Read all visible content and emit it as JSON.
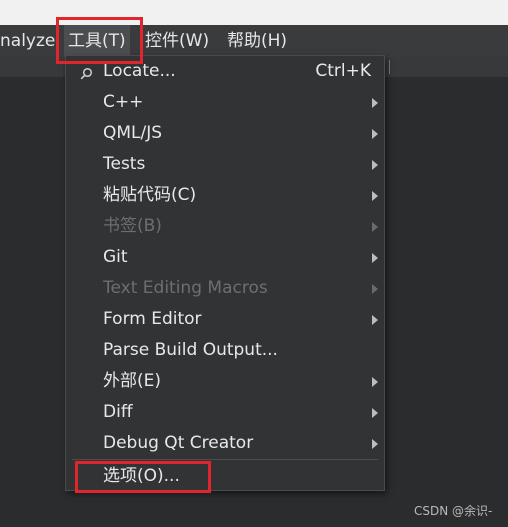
{
  "menubar": {
    "items": [
      {
        "label": "nalyze"
      },
      {
        "label": "工具(T)"
      },
      {
        "label": "控件(W)"
      },
      {
        "label": "帮助(H)"
      }
    ]
  },
  "tools_menu": {
    "items": [
      {
        "label": "Locate...",
        "shortcut": "Ctrl+K",
        "enabled": true,
        "submenu": false,
        "icon": "search-icon"
      },
      {
        "label": "C++",
        "enabled": true,
        "submenu": true
      },
      {
        "label": "QML/JS",
        "enabled": true,
        "submenu": true
      },
      {
        "label": "Tests",
        "enabled": true,
        "submenu": true
      },
      {
        "label": "粘贴代码(C)",
        "enabled": true,
        "submenu": true
      },
      {
        "label": "书签(B)",
        "enabled": false,
        "submenu": true
      },
      {
        "label": "Git",
        "enabled": true,
        "submenu": true
      },
      {
        "label": "Text Editing Macros",
        "enabled": false,
        "submenu": true
      },
      {
        "label": "Form Editor",
        "enabled": true,
        "submenu": true
      },
      {
        "label": "Parse Build Output...",
        "enabled": true,
        "submenu": false
      },
      {
        "label": "外部(E)",
        "enabled": true,
        "submenu": true
      },
      {
        "label": "Diff",
        "enabled": true,
        "submenu": true
      },
      {
        "label": "Debug Qt Creator",
        "enabled": true,
        "submenu": true
      },
      {
        "label": "选项(O)...",
        "enabled": true,
        "submenu": false
      }
    ]
  },
  "watermark": "CSDN @余识-",
  "colors": {
    "highlight_box": "#e0262c",
    "menu_bg": "#323335",
    "menubar_bg": "#3a3b3d",
    "disabled_text": "#6d6e70"
  }
}
